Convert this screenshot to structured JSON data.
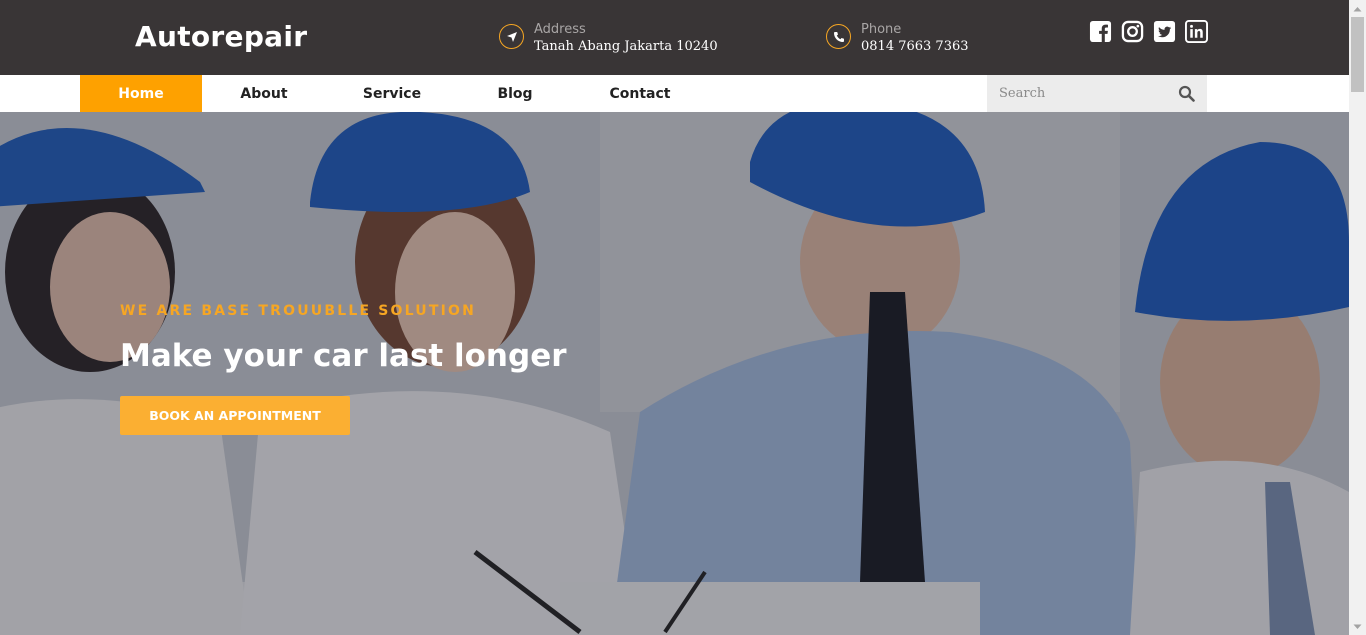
{
  "brand": {
    "name": "Autorepair"
  },
  "contact": {
    "address": {
      "label": "Address",
      "value": "Tanah Abang Jakarta 10240",
      "icon": "location-arrow-icon"
    },
    "phone": {
      "label": "Phone",
      "value": "0814 7663 7363",
      "icon": "phone-icon"
    }
  },
  "social": [
    {
      "name": "facebook-icon"
    },
    {
      "name": "instagram-icon"
    },
    {
      "name": "twitter-icon"
    },
    {
      "name": "linkedin-icon"
    }
  ],
  "nav": {
    "items": [
      {
        "label": "Home",
        "active": true
      },
      {
        "label": "About",
        "active": false
      },
      {
        "label": "Service",
        "active": false
      },
      {
        "label": "Blog",
        "active": false
      },
      {
        "label": "Contact",
        "active": false
      }
    ],
    "search": {
      "placeholder": "Search",
      "value": ""
    }
  },
  "hero": {
    "tagline": "WE ARE BASE TROUUBLLE SOLUTION",
    "headline": "Make your car last longer",
    "cta_label": "BOOK AN APPOINTMENT"
  },
  "colors": {
    "accent": "#fea100",
    "topbar": "#393536",
    "button": "#fbaf32"
  }
}
